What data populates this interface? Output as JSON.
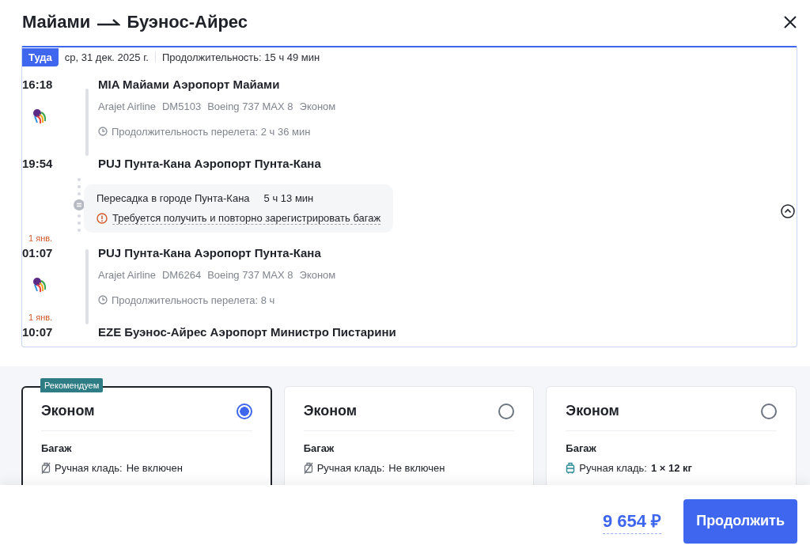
{
  "title": {
    "from": "Майами",
    "to": "Буэнос-Айрес"
  },
  "direction": {
    "label": "Туда",
    "date": "ср, 31 дек. 2025 г.",
    "duration": "Продолжительность: 15 ч 49 мин"
  },
  "segments": [
    {
      "departure": {
        "time": "16:18",
        "airport": "MIA Майами Аэропорт Майами"
      },
      "airline": "Arajet Airline",
      "flight": "DM5103",
      "aircraft": "Boeing 737 MAX 8",
      "cabin": "Эконом",
      "duration": "Продолжительность перелета: 2 ч 36 мин",
      "arrival": {
        "time": "19:54",
        "airport": "PUJ Пунта-Кана Аэропорт Пунта-Кана"
      }
    },
    {
      "departure": {
        "date": "1 янв.",
        "time": "01:07",
        "airport": "PUJ Пунта-Кана Аэропорт Пунта-Кана"
      },
      "airline": "Arajet Airline",
      "flight": "DM6264",
      "aircraft": "Boeing 737 MAX 8",
      "cabin": "Эконом",
      "duration": "Продолжительность перелета: 8 ч",
      "arrival": {
        "date": "1 янв.",
        "time": "10:07",
        "airport": "EZE Буэнос-Айрес Аэропорт Министро Пистарини"
      }
    }
  ],
  "layover": {
    "city": "Пересадка в городе Пунта-Кана",
    "duration": "5 ч 13 мин",
    "warning": "Требуется получить и повторно зарегистрировать багаж"
  },
  "fares": [
    {
      "badge": "Рекомендуем",
      "name": "Эконом",
      "selected": true,
      "section": "Багаж",
      "hand_baggage": {
        "label": "Ручная кладь:",
        "value": "Не включен",
        "included": false
      }
    },
    {
      "name": "Эконом",
      "selected": false,
      "section": "Багаж",
      "hand_baggage": {
        "label": "Ручная кладь:",
        "value": "Не включен",
        "included": false
      }
    },
    {
      "name": "Эконом",
      "selected": false,
      "section": "Багаж",
      "hand_baggage": {
        "label": "Ручная кладь:",
        "value": "1 × 12 кг",
        "included": true
      }
    }
  ],
  "price": "9 654 ₽",
  "continue_button": "Продолжить"
}
